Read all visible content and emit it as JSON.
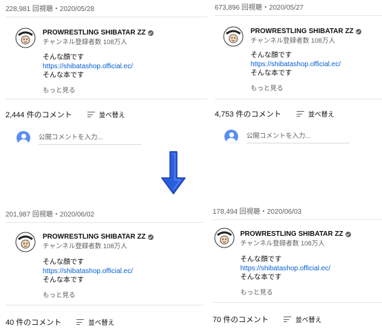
{
  "channel": {
    "name": "PROWRESTLING SHIBATAR ZZ",
    "subscribers": "チャンネル登録者数 108万人"
  },
  "description": {
    "line1": "そんな顔です",
    "link": "https://shibatashop.official.ec/",
    "line2": "そんな本です",
    "show_more": "もっと見る"
  },
  "sort_label": "並べ替え",
  "comment_placeholder": "公開コメントを入力...",
  "panels": [
    {
      "views_date": "228,981 回視聴・2020/05/28",
      "comment_count": "2,444 件のコメント"
    },
    {
      "views_date": "673,896 回視聴・2020/05/27",
      "comment_count": "4,753 件のコメント"
    },
    {
      "views_date": "201,987 回視聴・2020/06/02",
      "comment_count": "40 件のコメント"
    },
    {
      "views_date": "178,494 回視聴・2020/06/03",
      "comment_count": "70 件のコメント"
    }
  ],
  "colors": {
    "link": "#065fd4",
    "arrow": "#1f4fd0",
    "user_avatar": "#5b8ef0",
    "secondary_text": "#606060"
  }
}
